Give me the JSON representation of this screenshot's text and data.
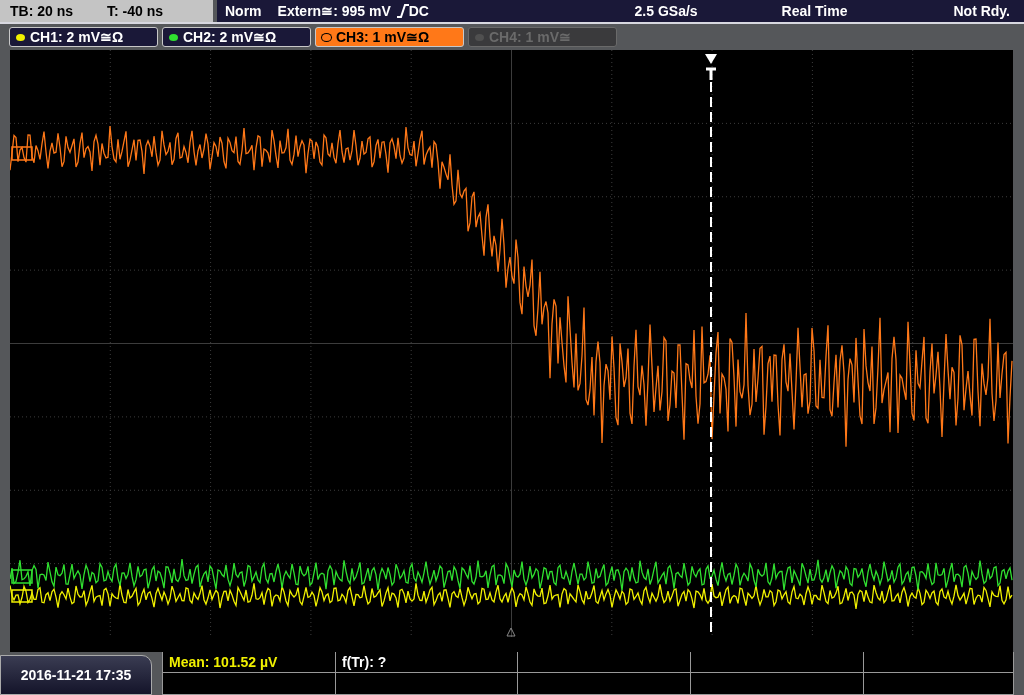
{
  "header": {
    "timebase": "TB: 20 ns",
    "trigger_time": "T: -40 ns",
    "trigger_mode": "Norm",
    "trigger_source": "Extern≅: 995 mV",
    "trigger_coupling": "DC",
    "sample_rate": "2.5 GSa/s",
    "acquisition": "Real Time",
    "status": "Not Rdy."
  },
  "channels": [
    {
      "label": "CH1: 2 mV≅Ω",
      "color": "#f0f000",
      "selected": false,
      "disabled": false
    },
    {
      "label": "CH2: 2 mV≅Ω",
      "color": "#30e030",
      "selected": false,
      "disabled": false
    },
    {
      "label": "CH3: 1 mV≅Ω",
      "color": "#ff7818",
      "selected": true,
      "disabled": false
    },
    {
      "label": "CH4: 1 mV≅",
      "color": "#505050",
      "selected": false,
      "disabled": true
    }
  ],
  "datetime": "2016-11-21 17:35",
  "measurements": [
    {
      "label": "Mean: 101.52 µV",
      "color": "#f0f000"
    },
    {
      "label": "f(Tr): ?",
      "color": "#ffffff"
    }
  ]
}
